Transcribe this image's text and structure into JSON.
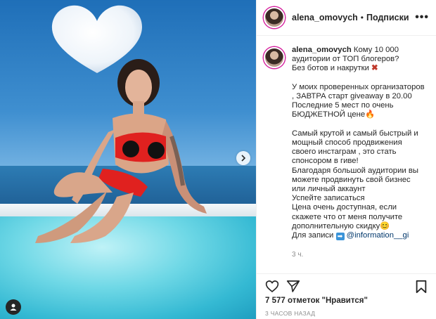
{
  "header": {
    "username": "alena_omovych",
    "separator": "•",
    "follow_label": "Подписки",
    "more_label": "•••"
  },
  "caption": {
    "username": "alena_omovych",
    "line1": "Кому 10 000 аудитории от ТОП блогеров?",
    "line2": "Без ботов и накрутки",
    "line2_emoji": "✖",
    "line3": "У моих проверенных организаторов , ЗАВТРА старт giveaway в 20.00",
    "line4": "Последние 5 мест по очень БЮДЖЕТНОЙ цене",
    "line4_emoji": "🔥",
    "line5": "Самый крутой и самый быстрый и мощный способ продвижения своего инстаграм , это стать спонсором в гиве!",
    "line6": "Благодаря большой аудитории вы можете продвинуть свой бизнес или личный аккаунт",
    "line7": "Успейте записаться",
    "line8": "Цена очень доступная, если скажете что от меня получите дополнительную скидку",
    "line8_emoji": "😊",
    "line9": "Для записи",
    "line9_emoji": "➡",
    "mention": "@information__gi",
    "time": "3 ч."
  },
  "footer": {
    "likes": "7 577 отметок \"Нравится\"",
    "date": "3 ЧАСОВ НАЗАД"
  },
  "icons": {
    "like": "heart-icon",
    "share": "paper-plane-icon",
    "save": "bookmark-icon",
    "next": "chevron-right-icon",
    "tags": "user-icon"
  },
  "colors": {
    "ring": "#d6249f",
    "text": "#262626",
    "muted": "#8e8e8e",
    "mention": "#00376b"
  }
}
